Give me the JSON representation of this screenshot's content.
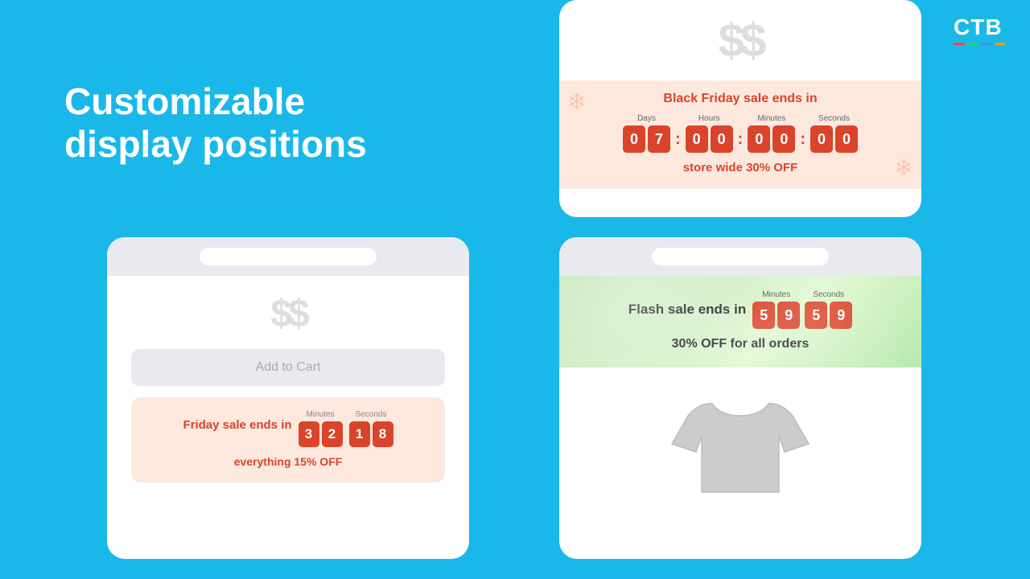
{
  "logo": {
    "text": "CTB",
    "bars": [
      {
        "color": "#e74c3c"
      },
      {
        "color": "#2ecc71"
      },
      {
        "color": "#3498db"
      },
      {
        "color": "#f39c12"
      }
    ]
  },
  "title": {
    "line1": "Customizable",
    "line2": "display positions"
  },
  "card_top_right": {
    "dollar_sign": "$$",
    "sale_title": "Black Friday sale ends in",
    "countdown": {
      "days_label": "Days",
      "hours_label": "Hours",
      "minutes_label": "Minutes",
      "seconds_label": "Seconds",
      "days": [
        "0",
        "7"
      ],
      "hours": [
        "0",
        "0"
      ],
      "minutes": [
        "0",
        "0"
      ],
      "seconds": [
        "0",
        "0"
      ]
    },
    "subtitle": "store wide 30% OFF"
  },
  "card_bottom_left": {
    "dollar_sign": "$$",
    "add_to_cart": "Add to Cart",
    "sale_title": "Friday sale ends in",
    "countdown": {
      "minutes_label": "Minutes",
      "seconds_label": "Seconds",
      "minutes": [
        "3",
        "2"
      ],
      "seconds": [
        "1",
        "8"
      ]
    },
    "subtitle": "everything 15% OFF"
  },
  "card_bottom_right": {
    "flash_title": "Flash sale ends in",
    "countdown": {
      "minutes_label": "Minutes",
      "seconds_label": "Seconds",
      "minutes": [
        "5",
        "9"
      ],
      "seconds": [
        "5",
        "9"
      ]
    },
    "subtitle": "30% OFF for all orders"
  }
}
